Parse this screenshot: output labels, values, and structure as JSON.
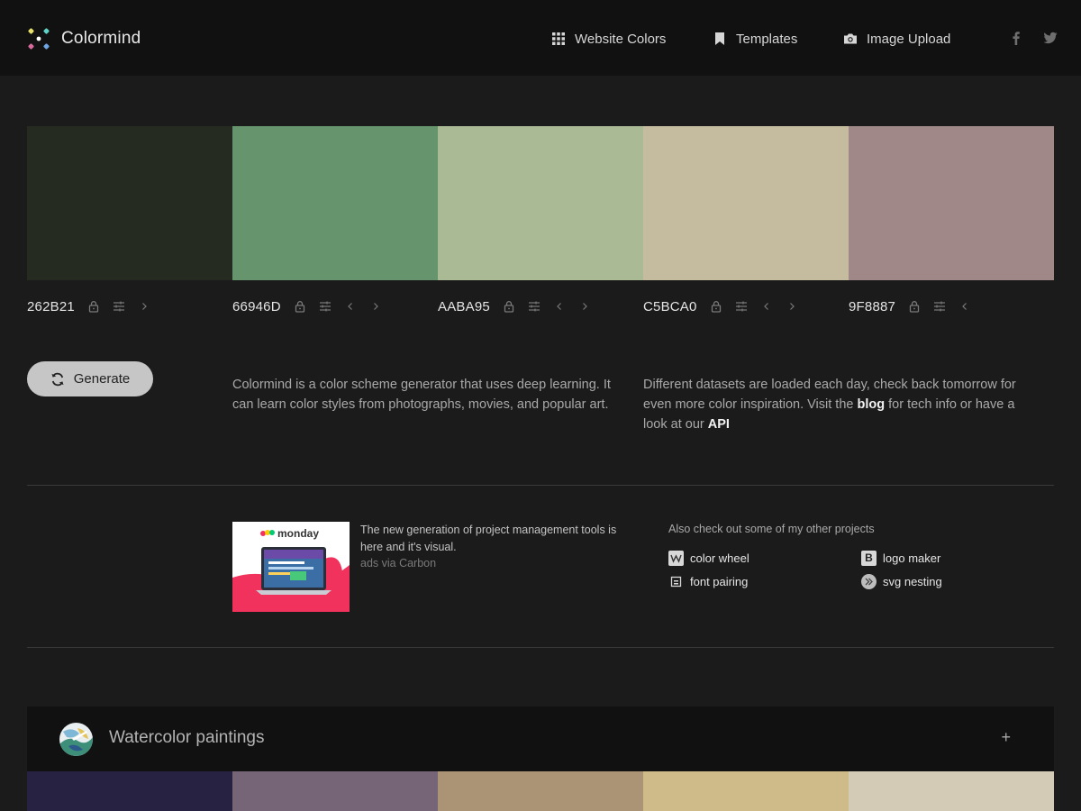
{
  "header": {
    "brand": "Colormind",
    "nav": {
      "website_colors": "Website Colors",
      "templates": "Templates",
      "image_upload": "Image Upload"
    }
  },
  "palette": [
    {
      "hex": "262B21",
      "color": "#262B21"
    },
    {
      "hex": "66946D",
      "color": "#66946D"
    },
    {
      "hex": "AABA95",
      "color": "#AABA95"
    },
    {
      "hex": "C5BCA0",
      "color": "#C5BCA0"
    },
    {
      "hex": "9F8887",
      "color": "#9F8887"
    }
  ],
  "generate_label": "Generate",
  "description": {
    "left": "Colormind is a color scheme generator that uses deep learning. It can learn color styles from photographs, movies, and popular art.",
    "right_before_blog": "Different datasets are loaded each day, check back tomorrow for even more color inspiration. Visit the ",
    "blog_link": "blog",
    "right_middle": " for tech info or have a look at our ",
    "api_link": "API"
  },
  "ad": {
    "logo_text": "monday",
    "text": "The new generation of project management tools is here and it's visual.",
    "via": "ads via Carbon"
  },
  "projects": {
    "title": "Also check out some of my other projects",
    "items": [
      "color wheel",
      "logo maker",
      "font pairing",
      "svg nesting"
    ]
  },
  "category": {
    "title": "Watercolor paintings",
    "plus": "+",
    "colors": [
      "#272241",
      "#756577",
      "#AB9375",
      "#CFBB89",
      "#D3CBB5"
    ]
  }
}
